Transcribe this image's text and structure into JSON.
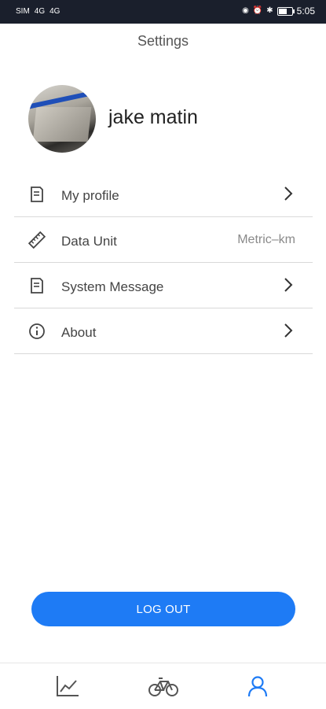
{
  "status_bar": {
    "left_indicators": [
      "SIM",
      "4G",
      "4G"
    ],
    "time": "5:05",
    "icons": [
      "eye-icon",
      "alarm-icon",
      "bluetooth-icon",
      "battery-icon"
    ]
  },
  "header": {
    "title": "Settings"
  },
  "profile": {
    "name": "jake matin"
  },
  "menu": {
    "items": [
      {
        "label": "My profile",
        "icon": "document-icon",
        "value": "",
        "has_chevron": true
      },
      {
        "label": "Data Unit",
        "icon": "ruler-icon",
        "value": "Metric–km",
        "has_chevron": false
      },
      {
        "label": "System Message",
        "icon": "message-icon",
        "value": "",
        "has_chevron": true
      },
      {
        "label": "About",
        "icon": "info-icon",
        "value": "",
        "has_chevron": true
      }
    ]
  },
  "actions": {
    "logout_label": "LOG OUT"
  },
  "tabbar": {
    "tabs": [
      {
        "name": "stats",
        "icon": "chart-line-icon",
        "active": false
      },
      {
        "name": "ride",
        "icon": "bicycle-icon",
        "active": false
      },
      {
        "name": "profile",
        "icon": "person-icon",
        "active": true
      }
    ]
  },
  "colors": {
    "accent": "#1e7bf5",
    "status_bar": "#1a1f2c",
    "divider": "#d9d9d9",
    "icon_inactive": "#555555"
  }
}
